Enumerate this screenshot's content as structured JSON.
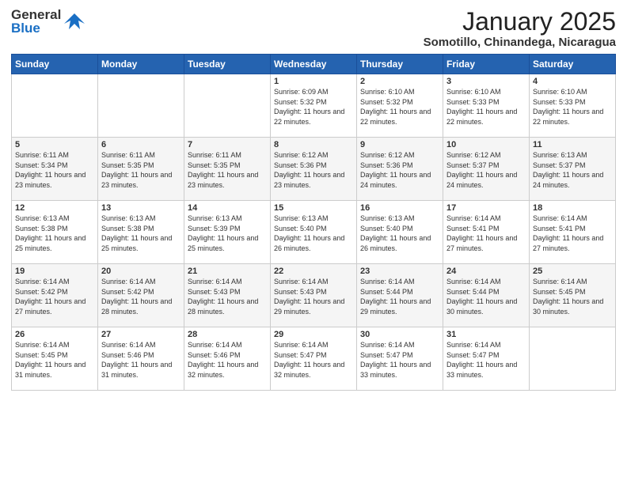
{
  "header": {
    "logo_general": "General",
    "logo_blue": "Blue",
    "month_title": "January 2025",
    "location": "Somotillo, Chinandega, Nicaragua"
  },
  "days_of_week": [
    "Sunday",
    "Monday",
    "Tuesday",
    "Wednesday",
    "Thursday",
    "Friday",
    "Saturday"
  ],
  "weeks": [
    [
      {
        "day": "",
        "sunrise": "",
        "sunset": "",
        "daylight": ""
      },
      {
        "day": "",
        "sunrise": "",
        "sunset": "",
        "daylight": ""
      },
      {
        "day": "",
        "sunrise": "",
        "sunset": "",
        "daylight": ""
      },
      {
        "day": "1",
        "sunrise": "Sunrise: 6:09 AM",
        "sunset": "Sunset: 5:32 PM",
        "daylight": "Daylight: 11 hours and 22 minutes."
      },
      {
        "day": "2",
        "sunrise": "Sunrise: 6:10 AM",
        "sunset": "Sunset: 5:32 PM",
        "daylight": "Daylight: 11 hours and 22 minutes."
      },
      {
        "day": "3",
        "sunrise": "Sunrise: 6:10 AM",
        "sunset": "Sunset: 5:33 PM",
        "daylight": "Daylight: 11 hours and 22 minutes."
      },
      {
        "day": "4",
        "sunrise": "Sunrise: 6:10 AM",
        "sunset": "Sunset: 5:33 PM",
        "daylight": "Daylight: 11 hours and 22 minutes."
      }
    ],
    [
      {
        "day": "5",
        "sunrise": "Sunrise: 6:11 AM",
        "sunset": "Sunset: 5:34 PM",
        "daylight": "Daylight: 11 hours and 23 minutes."
      },
      {
        "day": "6",
        "sunrise": "Sunrise: 6:11 AM",
        "sunset": "Sunset: 5:35 PM",
        "daylight": "Daylight: 11 hours and 23 minutes."
      },
      {
        "day": "7",
        "sunrise": "Sunrise: 6:11 AM",
        "sunset": "Sunset: 5:35 PM",
        "daylight": "Daylight: 11 hours and 23 minutes."
      },
      {
        "day": "8",
        "sunrise": "Sunrise: 6:12 AM",
        "sunset": "Sunset: 5:36 PM",
        "daylight": "Daylight: 11 hours and 23 minutes."
      },
      {
        "day": "9",
        "sunrise": "Sunrise: 6:12 AM",
        "sunset": "Sunset: 5:36 PM",
        "daylight": "Daylight: 11 hours and 24 minutes."
      },
      {
        "day": "10",
        "sunrise": "Sunrise: 6:12 AM",
        "sunset": "Sunset: 5:37 PM",
        "daylight": "Daylight: 11 hours and 24 minutes."
      },
      {
        "day": "11",
        "sunrise": "Sunrise: 6:13 AM",
        "sunset": "Sunset: 5:37 PM",
        "daylight": "Daylight: 11 hours and 24 minutes."
      }
    ],
    [
      {
        "day": "12",
        "sunrise": "Sunrise: 6:13 AM",
        "sunset": "Sunset: 5:38 PM",
        "daylight": "Daylight: 11 hours and 25 minutes."
      },
      {
        "day": "13",
        "sunrise": "Sunrise: 6:13 AM",
        "sunset": "Sunset: 5:38 PM",
        "daylight": "Daylight: 11 hours and 25 minutes."
      },
      {
        "day": "14",
        "sunrise": "Sunrise: 6:13 AM",
        "sunset": "Sunset: 5:39 PM",
        "daylight": "Daylight: 11 hours and 25 minutes."
      },
      {
        "day": "15",
        "sunrise": "Sunrise: 6:13 AM",
        "sunset": "Sunset: 5:40 PM",
        "daylight": "Daylight: 11 hours and 26 minutes."
      },
      {
        "day": "16",
        "sunrise": "Sunrise: 6:13 AM",
        "sunset": "Sunset: 5:40 PM",
        "daylight": "Daylight: 11 hours and 26 minutes."
      },
      {
        "day": "17",
        "sunrise": "Sunrise: 6:14 AM",
        "sunset": "Sunset: 5:41 PM",
        "daylight": "Daylight: 11 hours and 27 minutes."
      },
      {
        "day": "18",
        "sunrise": "Sunrise: 6:14 AM",
        "sunset": "Sunset: 5:41 PM",
        "daylight": "Daylight: 11 hours and 27 minutes."
      }
    ],
    [
      {
        "day": "19",
        "sunrise": "Sunrise: 6:14 AM",
        "sunset": "Sunset: 5:42 PM",
        "daylight": "Daylight: 11 hours and 27 minutes."
      },
      {
        "day": "20",
        "sunrise": "Sunrise: 6:14 AM",
        "sunset": "Sunset: 5:42 PM",
        "daylight": "Daylight: 11 hours and 28 minutes."
      },
      {
        "day": "21",
        "sunrise": "Sunrise: 6:14 AM",
        "sunset": "Sunset: 5:43 PM",
        "daylight": "Daylight: 11 hours and 28 minutes."
      },
      {
        "day": "22",
        "sunrise": "Sunrise: 6:14 AM",
        "sunset": "Sunset: 5:43 PM",
        "daylight": "Daylight: 11 hours and 29 minutes."
      },
      {
        "day": "23",
        "sunrise": "Sunrise: 6:14 AM",
        "sunset": "Sunset: 5:44 PM",
        "daylight": "Daylight: 11 hours and 29 minutes."
      },
      {
        "day": "24",
        "sunrise": "Sunrise: 6:14 AM",
        "sunset": "Sunset: 5:44 PM",
        "daylight": "Daylight: 11 hours and 30 minutes."
      },
      {
        "day": "25",
        "sunrise": "Sunrise: 6:14 AM",
        "sunset": "Sunset: 5:45 PM",
        "daylight": "Daylight: 11 hours and 30 minutes."
      }
    ],
    [
      {
        "day": "26",
        "sunrise": "Sunrise: 6:14 AM",
        "sunset": "Sunset: 5:45 PM",
        "daylight": "Daylight: 11 hours and 31 minutes."
      },
      {
        "day": "27",
        "sunrise": "Sunrise: 6:14 AM",
        "sunset": "Sunset: 5:46 PM",
        "daylight": "Daylight: 11 hours and 31 minutes."
      },
      {
        "day": "28",
        "sunrise": "Sunrise: 6:14 AM",
        "sunset": "Sunset: 5:46 PM",
        "daylight": "Daylight: 11 hours and 32 minutes."
      },
      {
        "day": "29",
        "sunrise": "Sunrise: 6:14 AM",
        "sunset": "Sunset: 5:47 PM",
        "daylight": "Daylight: 11 hours and 32 minutes."
      },
      {
        "day": "30",
        "sunrise": "Sunrise: 6:14 AM",
        "sunset": "Sunset: 5:47 PM",
        "daylight": "Daylight: 11 hours and 33 minutes."
      },
      {
        "day": "31",
        "sunrise": "Sunrise: 6:14 AM",
        "sunset": "Sunset: 5:47 PM",
        "daylight": "Daylight: 11 hours and 33 minutes."
      },
      {
        "day": "",
        "sunrise": "",
        "sunset": "",
        "daylight": ""
      }
    ]
  ]
}
